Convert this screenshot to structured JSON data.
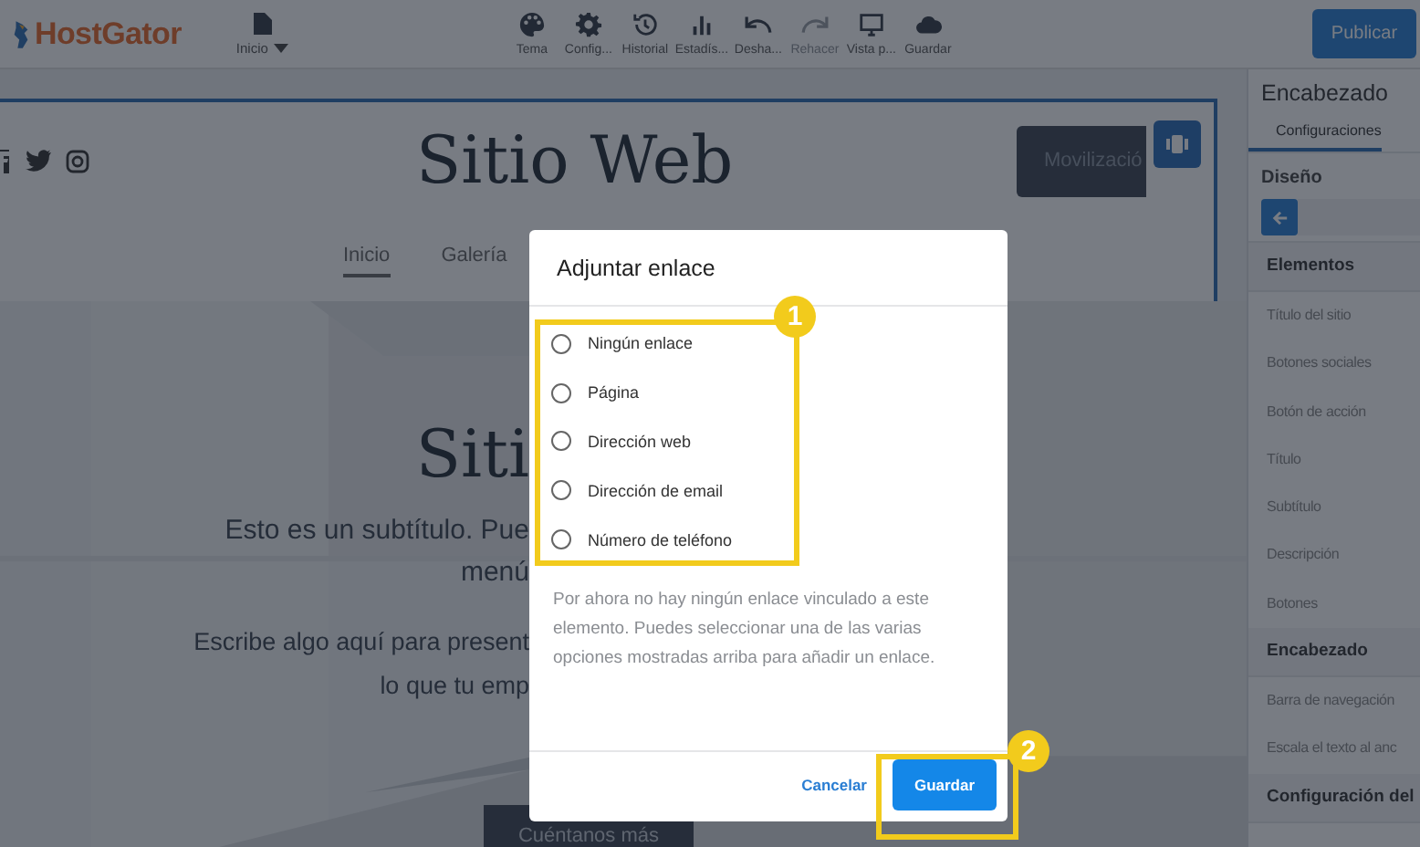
{
  "topbar": {
    "logo": "HostGator",
    "page_menu": "Inicio",
    "tools": [
      {
        "label": "Tema",
        "disabled": false
      },
      {
        "label": "Config...",
        "disabled": false
      },
      {
        "label": "Historial",
        "disabled": false
      },
      {
        "label": "Estadís...",
        "disabled": false
      },
      {
        "label": "Desha...",
        "disabled": false
      },
      {
        "label": "Rehacer",
        "disabled": true
      },
      {
        "label": "Vista p...",
        "disabled": false
      },
      {
        "label": "Guardar",
        "disabled": false
      }
    ],
    "publish_button": "Publicar"
  },
  "site_header": {
    "title": "Sitio Web",
    "action_button": "Movilizació",
    "nav": [
      {
        "label": "Inicio",
        "selected": true
      },
      {
        "label": "Galería",
        "selected": false
      }
    ]
  },
  "hero": {
    "title": "Siti",
    "lines": [
      "Esto es un subtítulo. Pue",
      "menú",
      "Escribe algo aquí para present",
      "lo que tu emp"
    ],
    "button": "Cuéntanos más"
  },
  "dialog": {
    "title": "Adjuntar enlace",
    "options": [
      {
        "label": "Ningún enlace",
        "selected": false
      },
      {
        "label": "Página",
        "selected": false
      },
      {
        "label": "Dirección web",
        "selected": false
      },
      {
        "label": "Dirección de email",
        "selected": false
      },
      {
        "label": "Número de teléfono",
        "selected": false
      }
    ],
    "description": "Por ahora no hay ningún enlace vinculado a este elemento. Puedes seleccionar una de las varias opciones mostradas arriba para añadir un enlace.",
    "cancel": "Cancelar",
    "save": "Guardar"
  },
  "annotations": [
    "1",
    "2"
  ],
  "side_panel": {
    "title": "Encabezado",
    "tabs": [
      {
        "label": "Configuraciones",
        "selected": true
      }
    ],
    "section": "Diseño",
    "groups": [
      {
        "title": "Elementos",
        "items": [
          "Título del sitio",
          "Botones sociales",
          "Botón de acción",
          "Título",
          "Subtítulo",
          "Descripción",
          "Botones"
        ]
      },
      {
        "title": "Encabezado",
        "items": [
          "Barra de navegación",
          "Escala el texto al anc"
        ]
      },
      {
        "title": "Configuración del"
      }
    ]
  }
}
